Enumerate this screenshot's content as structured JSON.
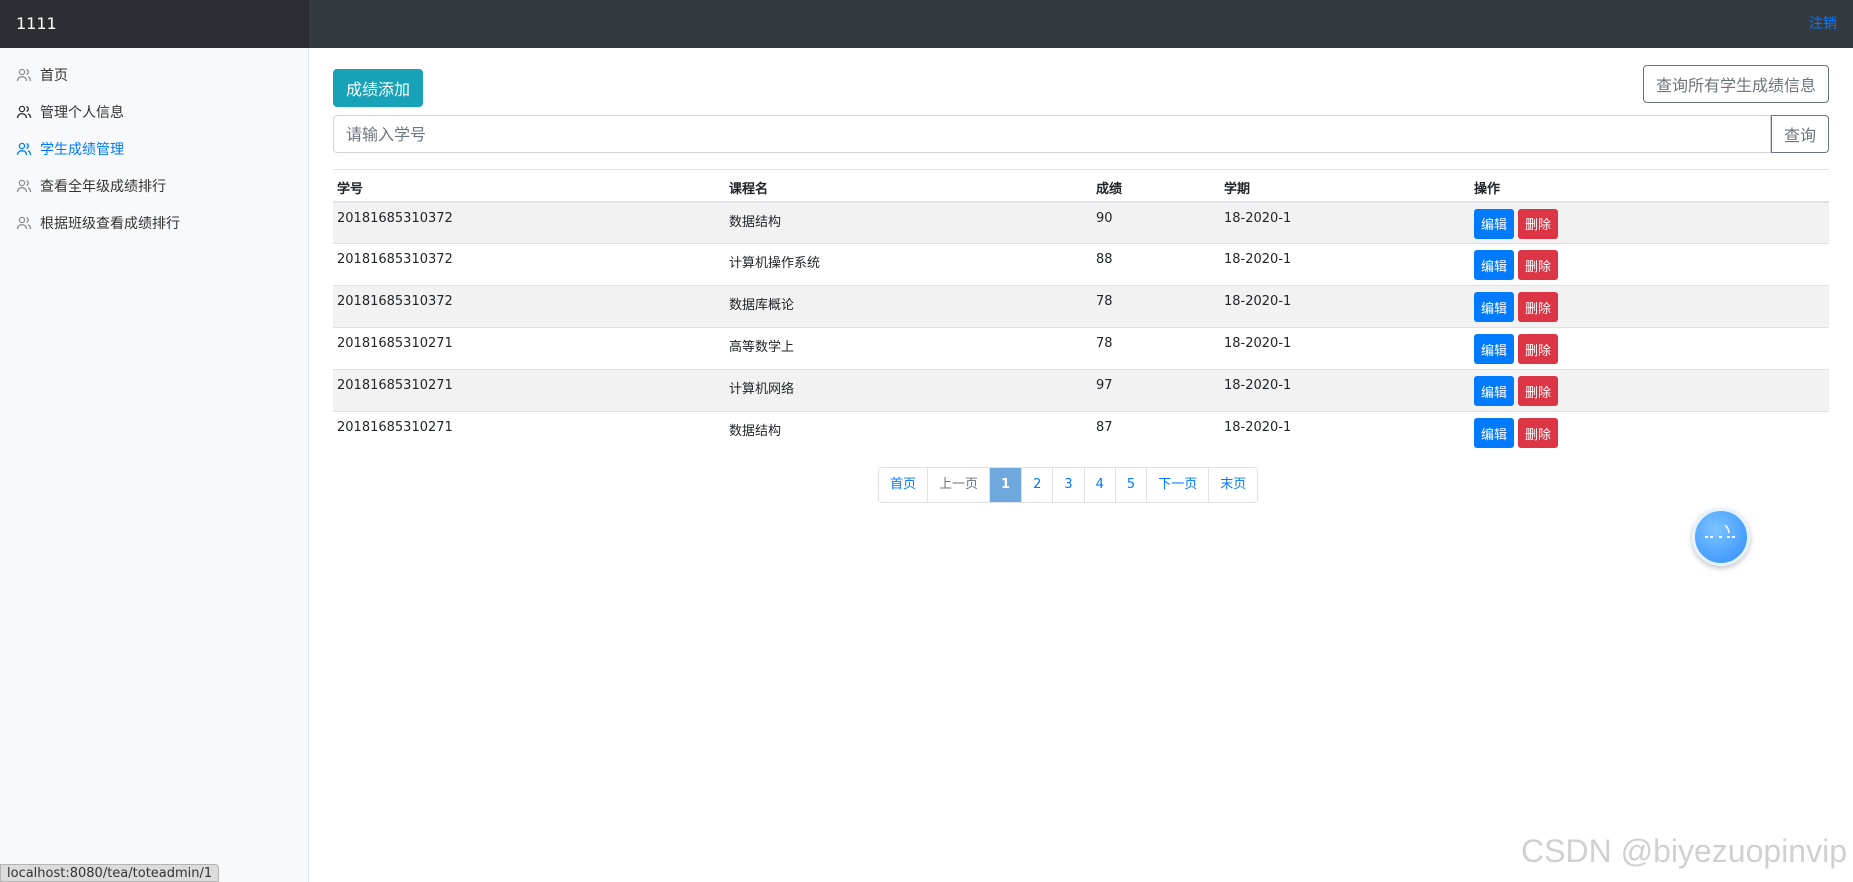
{
  "header": {
    "brand": "1111",
    "logout": "注销"
  },
  "sidebar": {
    "items": [
      {
        "label": "首页",
        "icon": "users-icon"
      },
      {
        "label": "管理个人信息",
        "icon": "users-icon"
      },
      {
        "label": "学生成绩管理",
        "icon": "users-icon",
        "active": true
      },
      {
        "label": "查看全年级成绩排行",
        "icon": "users-icon"
      },
      {
        "label": "根据班级查看成绩排行",
        "icon": "users-icon"
      }
    ]
  },
  "toolbar": {
    "add_label": "成绩添加",
    "query_all_label": "查询所有学生成绩信息"
  },
  "search": {
    "placeholder": "请输入学号",
    "button": "查询"
  },
  "table": {
    "headers": [
      "学号",
      "课程名",
      "成绩",
      "学期",
      "操作"
    ],
    "rows": [
      {
        "id": "20181685310372",
        "course": "数据结构",
        "score": "90",
        "term": "18-2020-1"
      },
      {
        "id": "20181685310372",
        "course": "计算机操作系统",
        "score": "88",
        "term": "18-2020-1"
      },
      {
        "id": "20181685310372",
        "course": "数据库概论",
        "score": "78",
        "term": "18-2020-1"
      },
      {
        "id": "20181685310271",
        "course": "高等数学上",
        "score": "78",
        "term": "18-2020-1"
      },
      {
        "id": "20181685310271",
        "course": "计算机网络",
        "score": "97",
        "term": "18-2020-1"
      },
      {
        "id": "20181685310271",
        "course": "数据结构",
        "score": "87",
        "term": "18-2020-1"
      }
    ],
    "edit_label": "编辑",
    "delete_label": "删除"
  },
  "pagination": {
    "first": "首页",
    "prev": "上一页",
    "pages": [
      "1",
      "2",
      "3",
      "4",
      "5"
    ],
    "current": "1",
    "next": "下一页",
    "last": "末页"
  },
  "status_bar": {
    "url": "localhost:8080/tea/toteadmin/1"
  },
  "watermark": "CSDN @biyezuopinvip",
  "colors": {
    "accent": "#007bff",
    "add": "#17a2b8",
    "danger": "#dc3545",
    "topbar": "#343a40"
  }
}
